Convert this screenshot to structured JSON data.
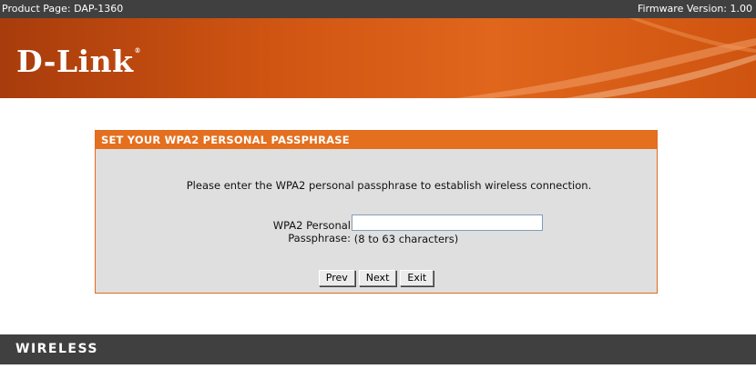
{
  "topbar": {
    "product": "Product Page: DAP-1360",
    "firmware": "Firmware Version: 1.00"
  },
  "banner": {
    "logo_text": "D-Link",
    "logo_mark": "®"
  },
  "panel": {
    "title": "SET YOUR WPA2 PERSONAL PASSPHRASE",
    "instruction": "Please enter the WPA2 personal passphrase to establish wireless connection.",
    "passphrase_label": "WPA2 Personal Passphrase:",
    "passphrase_value": "",
    "passphrase_hint": "(8 to 63 characters)"
  },
  "buttons": {
    "prev": "Prev",
    "next": "Next",
    "exit": "Exit"
  },
  "footer": {
    "label": "WIRELESS"
  },
  "colors": {
    "accent_orange": "#e46f1e",
    "dark_bar": "#404040",
    "panel_bg": "#dfdfdf"
  }
}
